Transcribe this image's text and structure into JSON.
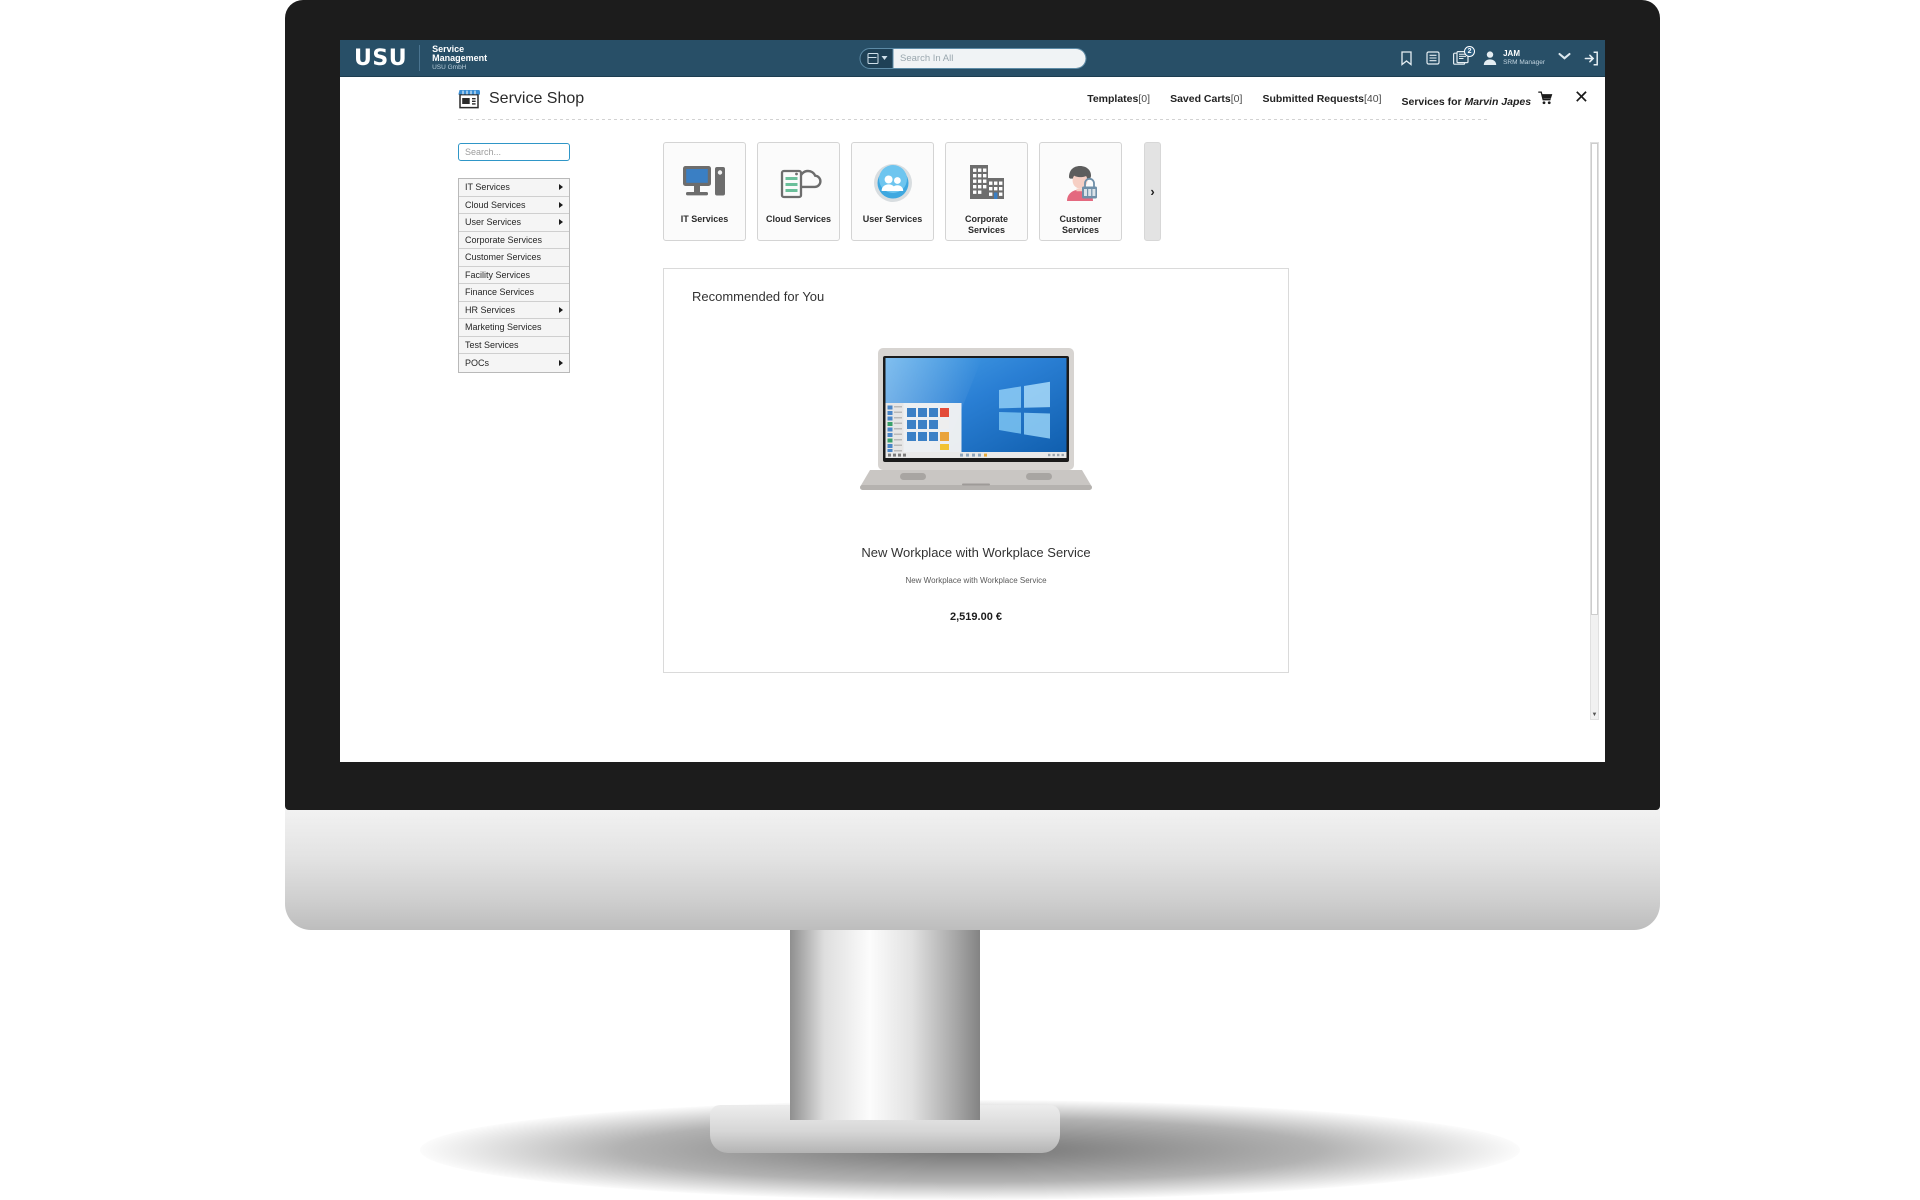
{
  "topbar": {
    "logo": {
      "brand": "USU",
      "line1": "Service",
      "line2": "Management",
      "line3": "USU GmbH"
    },
    "search": {
      "placeholder": "Search In All",
      "value": "",
      "scope_icon": "archive-icon",
      "caret_icon": "chevron-down-icon"
    },
    "icons": [
      {
        "name": "bookmark-icon",
        "label": "Bookmarks"
      },
      {
        "name": "list-icon",
        "label": "Lists"
      },
      {
        "name": "news-icon",
        "label": "News",
        "badge": "2"
      }
    ],
    "user": {
      "name": "JAM",
      "role": "SRM Manager",
      "avatar_icon": "avatar-icon",
      "caret": "⌄"
    },
    "logout_icon": "logout-icon"
  },
  "page": {
    "title": "Service Shop",
    "title_icon": "shop-icon",
    "close_label": "✕",
    "nav_links": [
      {
        "label": "Templates",
        "count": "[0]"
      },
      {
        "label": "Saved Carts",
        "count": "[0]"
      },
      {
        "label": "Submitted Requests",
        "count": "[40]"
      }
    ],
    "services_for": {
      "prefix": "Services for ",
      "person": "Marvin Japes",
      "cart_icon": "shopping-cart-icon"
    }
  },
  "sidebar": {
    "search_placeholder": "Search...",
    "search_value": "",
    "categories": [
      {
        "label": "IT Services",
        "has_children": true
      },
      {
        "label": "Cloud Services",
        "has_children": true
      },
      {
        "label": "User Services",
        "has_children": true
      },
      {
        "label": "Corporate Services",
        "has_children": false
      },
      {
        "label": "Customer Services",
        "has_children": false
      },
      {
        "label": "Facility Services",
        "has_children": false
      },
      {
        "label": "Finance Services",
        "has_children": false
      },
      {
        "label": "HR Services",
        "has_children": true
      },
      {
        "label": "Marketing Services",
        "has_children": false
      },
      {
        "label": "Test Services",
        "has_children": false
      },
      {
        "label": "POCs",
        "has_children": true
      }
    ]
  },
  "tiles": [
    {
      "label": "IT Services",
      "icon": "desktop-computer-icon"
    },
    {
      "label": "Cloud Services",
      "icon": "cloud-server-icon"
    },
    {
      "label": "User Services",
      "icon": "users-globe-icon"
    },
    {
      "label": "Corporate Services",
      "icon": "office-buildings-icon"
    },
    {
      "label": "Customer Services",
      "icon": "shopper-person-icon"
    }
  ],
  "carousel": {
    "next_label": "›"
  },
  "recommended": {
    "title": "Recommended for You",
    "product": {
      "name": "New Workplace with Workplace Service",
      "description": "New Workplace with Workplace Service",
      "price": "2,519.00 €",
      "image_alt": "laptop-windows-desktop"
    }
  },
  "colors": {
    "topbar_bg": "#284f67",
    "accent_focus": "#2f96c7",
    "tile_border": "#d4d4d4",
    "icon_gray": "#6d6d6d",
    "screen_blue": "#2f7fd0"
  }
}
